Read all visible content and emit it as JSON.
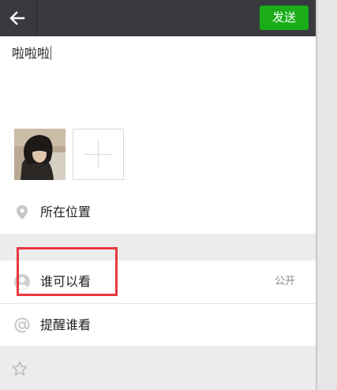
{
  "topbar": {
    "back_icon": "arrow-left-icon",
    "send_label": "发送",
    "accent": "#1aad19",
    "bar_color": "#393a3f"
  },
  "composer": {
    "text": "啦啦啦"
  },
  "photos": {
    "add_icon": "plus-icon"
  },
  "rows": {
    "location": {
      "label": "所在位置",
      "icon": "location-pin-icon"
    },
    "visibility": {
      "label": "谁可以看",
      "value": "公开",
      "icon": "person-icon"
    },
    "remind": {
      "label": "提醒谁看",
      "icon": "at-icon"
    },
    "favorite": {
      "icon": "star-icon"
    }
  },
  "highlight_color": "#e8383d"
}
